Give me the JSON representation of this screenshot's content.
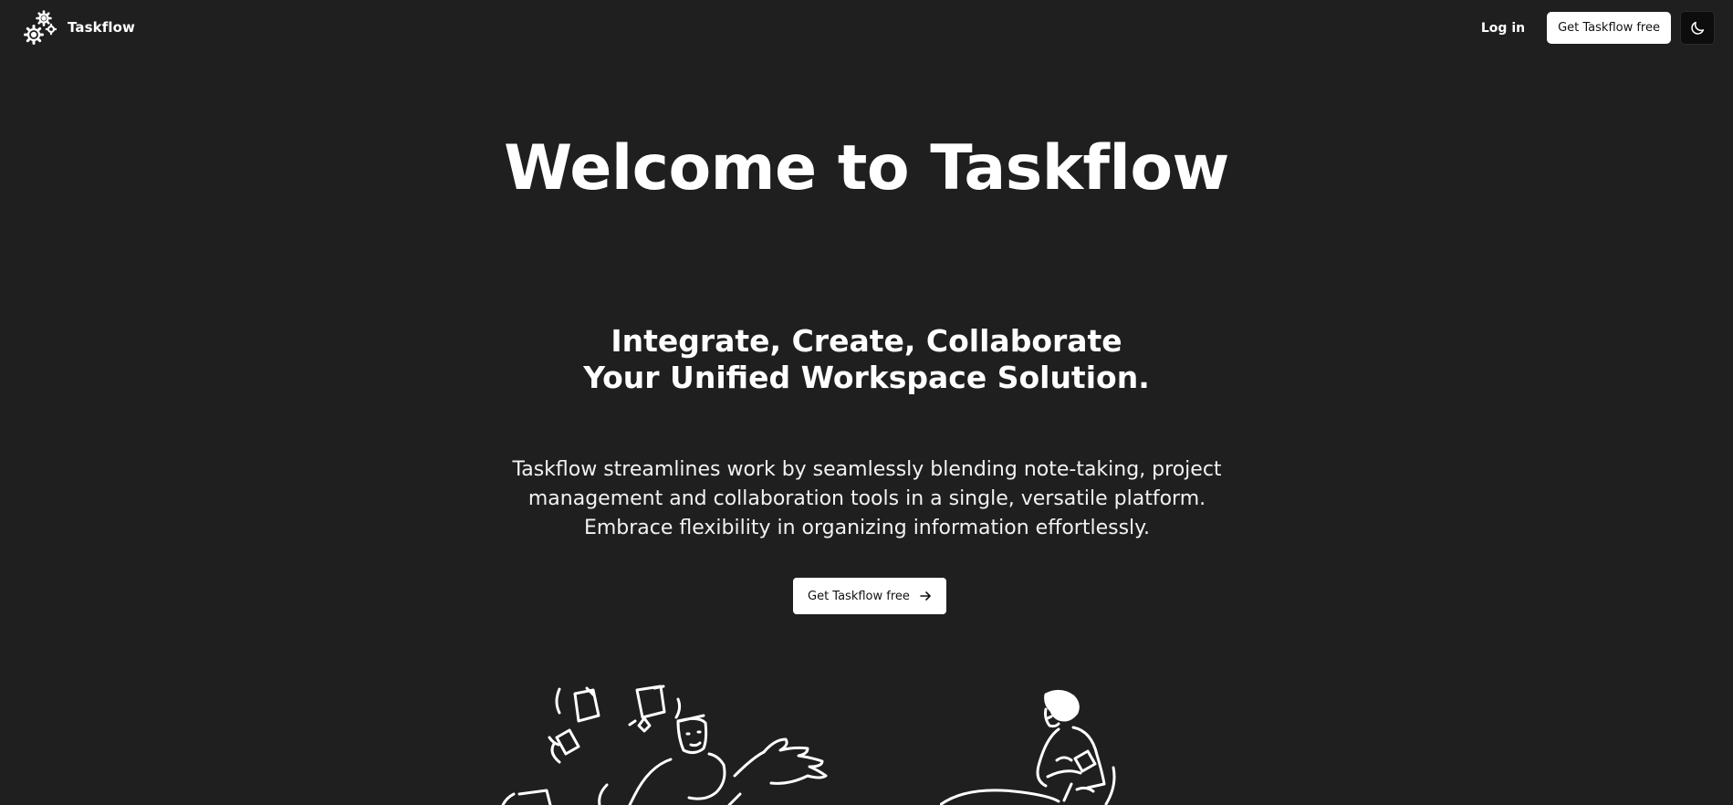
{
  "header": {
    "brand_name": "Taskflow",
    "login_label": "Log in",
    "cta_label": "Get Taskflow free",
    "theme_icon": "moon-icon"
  },
  "hero": {
    "title": "Welcome to Taskflow",
    "subtitle_line1": "Integrate, Create, Collaborate",
    "subtitle_line2": "Your Unified Workspace Solution.",
    "description": "Taskflow streamlines work by seamlessly blending note-taking, project management and collaboration tools in a single, versatile platform. Embrace flexibility in organizing information effortlessly.",
    "cta_label": "Get Taskflow free",
    "cta_icon": "arrow-right-icon"
  },
  "colors": {
    "background": "#1f1f1f",
    "text": "#ffffff",
    "button_bg": "#ffffff",
    "button_text": "#111111"
  }
}
